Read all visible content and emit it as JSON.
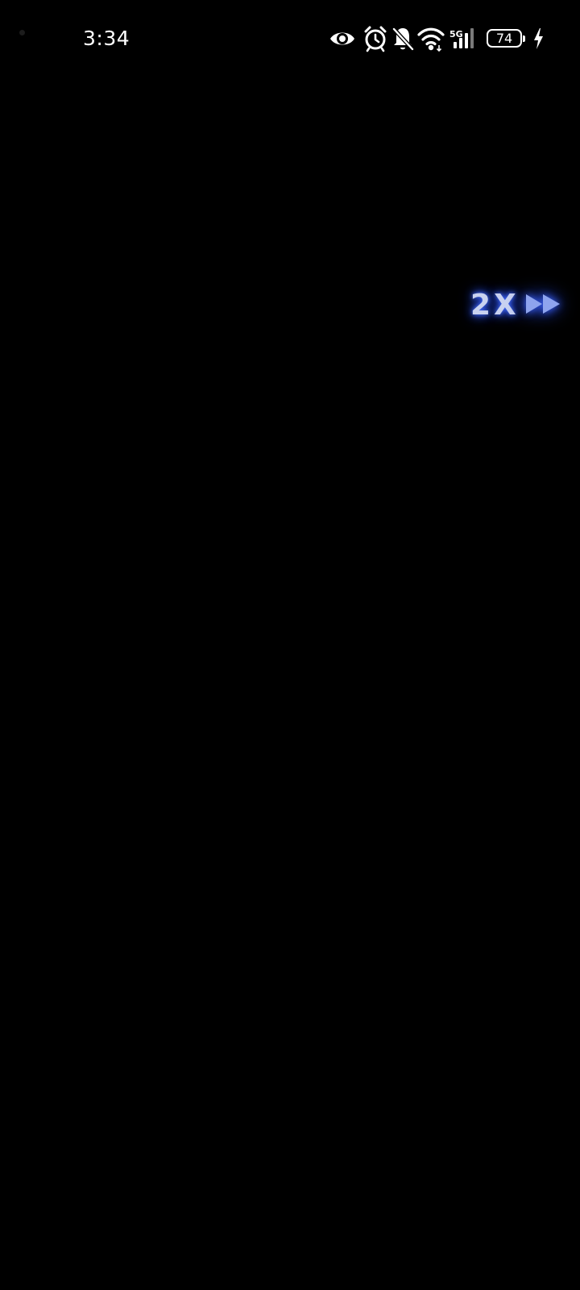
{
  "status_bar": {
    "time": "3:34",
    "icons": [
      "eye-icon",
      "alarm-icon",
      "notifications-off-icon",
      "wifi-icon",
      "cellular-signal-icon",
      "battery-icon",
      "charging-bolt-icon"
    ],
    "network_type": "5G",
    "battery_level": "74",
    "charging": true
  },
  "playback_overlay": {
    "speed_label": "2X",
    "icon": "fast-forward-icon",
    "glow_color": "#3a62ff",
    "text_color": "#c9d2f0"
  },
  "colors": {
    "background": "#000000",
    "status_text": "#ffffff"
  }
}
